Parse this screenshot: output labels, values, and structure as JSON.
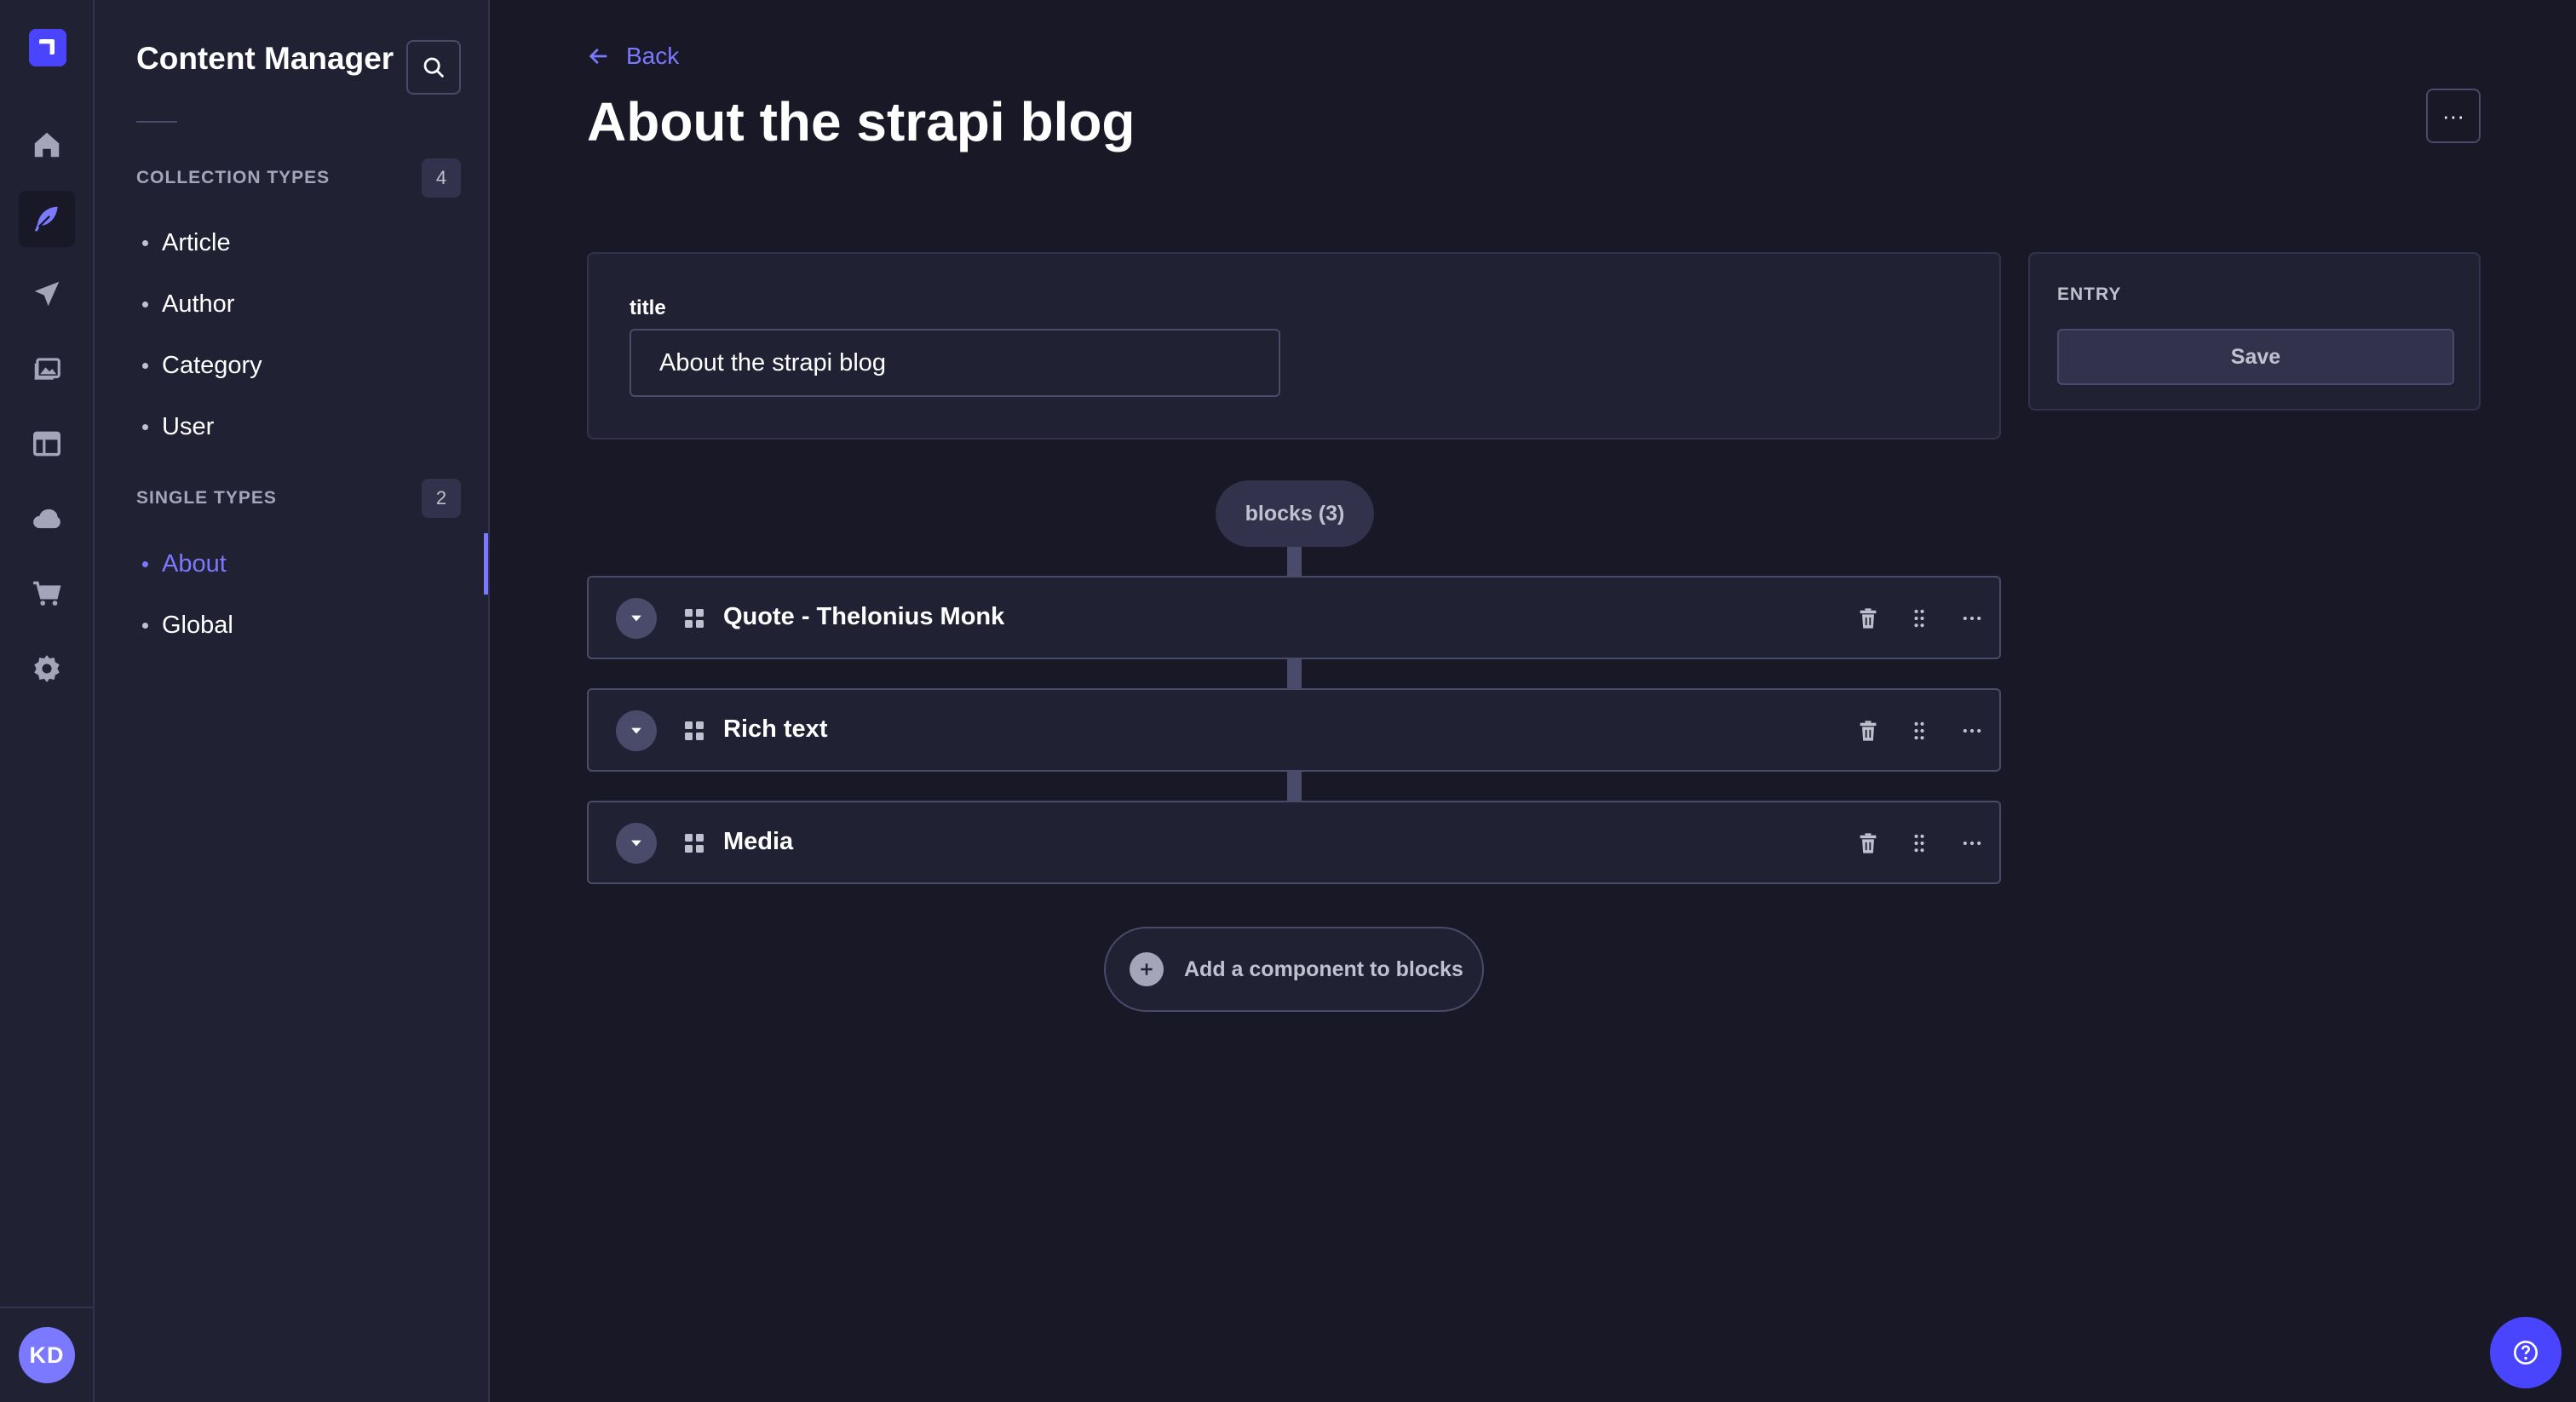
{
  "colors": {
    "background": "#181826",
    "panel": "#212134",
    "border": "#32324d",
    "accent": "#7b79ff",
    "primary": "#4945ff",
    "muted_text": "#a5a5ba"
  },
  "rail": {
    "items": [
      {
        "name": "home",
        "icon": "home-icon"
      },
      {
        "name": "content-manager",
        "icon": "feather-icon",
        "active": true
      },
      {
        "name": "content-releases",
        "icon": "paper-plane-icon"
      },
      {
        "name": "media-library",
        "icon": "images-icon"
      },
      {
        "name": "content-type-builder",
        "icon": "layout-icon"
      },
      {
        "name": "deploy",
        "icon": "cloud-icon"
      },
      {
        "name": "marketplace",
        "icon": "cart-icon"
      },
      {
        "name": "settings",
        "icon": "gear-icon"
      }
    ],
    "avatar_initials": "KD"
  },
  "subnav": {
    "title": "Content Manager",
    "collection_types": {
      "label": "COLLECTION TYPES",
      "count": "4",
      "items": [
        "Article",
        "Author",
        "Category",
        "User"
      ]
    },
    "single_types": {
      "label": "SINGLE TYPES",
      "count": "2",
      "items": [
        "About",
        "Global"
      ],
      "active": "About"
    }
  },
  "header": {
    "back_label": "Back",
    "title": "About the strapi blog",
    "more_label": "···"
  },
  "form": {
    "title_label": "title",
    "title_value": "About the strapi blog"
  },
  "entry_panel": {
    "label": "ENTRY",
    "save_label": "Save"
  },
  "blocks": {
    "label": "blocks (3)",
    "items": [
      {
        "title": "Quote - Thelonius Monk"
      },
      {
        "title": "Rich text"
      },
      {
        "title": "Media"
      }
    ],
    "add_label": "Add a component to blocks"
  }
}
